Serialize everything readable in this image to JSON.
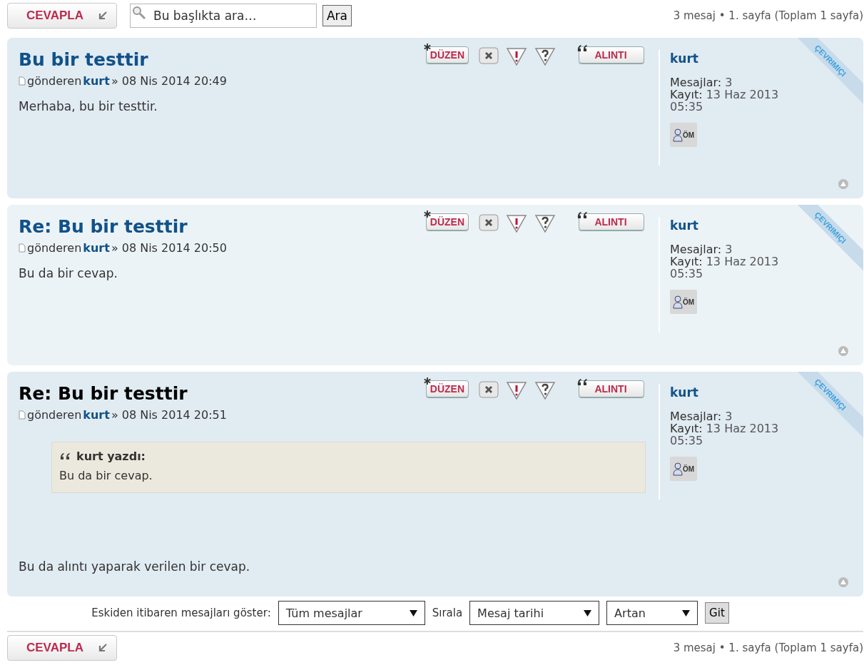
{
  "top_bar": {
    "reply_button": "CEVAPLA",
    "search": {
      "placeholder": "Bu başlıkta ara…"
    },
    "search_button": "Ara",
    "pagination": "3 mesaj • 1. sayfa (Toplam 1 sayfa)"
  },
  "posts": [
    {
      "title": "Bu bir testtir",
      "highlighted": false,
      "byline": "gönderen",
      "author": "kurt",
      "date": "» 08 Nis 2014 20:49",
      "actions": {
        "edit": "DÜZEN",
        "quote": "ALINTI"
      },
      "body": "Merhaba, bu bir testtir.",
      "profile": {
        "name": "kurt",
        "posts_label": "Mesajlar:",
        "posts": "3",
        "joined_label": "Kayıt:",
        "joined": "13 Haz 2013 05:35",
        "pm": "ÖM",
        "online": true,
        "online_label": "ÇEVRIMIÇI"
      }
    },
    {
      "title": "Re: Bu bir testtir",
      "highlighted": false,
      "byline": "gönderen",
      "author": "kurt",
      "date": "» 08 Nis 2014 20:50",
      "actions": {
        "edit": "DÜZEN",
        "quote": "ALINTI"
      },
      "body": "Bu da bir cevap.",
      "profile": {
        "name": "kurt",
        "posts_label": "Mesajlar:",
        "posts": "3",
        "joined_label": "Kayıt:",
        "joined": "13 Haz 2013 05:35",
        "pm": "ÖM",
        "online": true,
        "online_label": "ÇEVRIMIÇI"
      }
    },
    {
      "title": "Re: Bu bir testtir",
      "highlighted": true,
      "byline": "gönderen",
      "author": "kurt",
      "date": "» 08 Nis 2014 20:51",
      "actions": {
        "edit": "DÜZEN",
        "quote": "ALINTI"
      },
      "quote": {
        "cite": "kurt yazdı:",
        "text": "Bu da bir cevap."
      },
      "body": "Bu da alıntı yaparak verilen bir cevap.",
      "profile": {
        "name": "kurt",
        "posts_label": "Mesajlar:",
        "posts": "3",
        "joined_label": "Kayıt:",
        "joined": "13 Haz 2013 05:35",
        "pm": "ÖM",
        "online": true,
        "online_label": "ÇEVRIMIÇI"
      }
    }
  ],
  "sort_bar": {
    "show_label": "Eskiden itibaren mesajları göster:",
    "show_value": "Tüm mesajlar",
    "sort_label": "Sırala",
    "sort_value": "Mesaj tarihi",
    "order_value": "Artan",
    "go_button": "Git"
  },
  "bottom_bar": {
    "reply_button": "CEVAPLA",
    "pagination": "3 mesaj • 1. sayfa (Toplam 1 sayfa)"
  }
}
